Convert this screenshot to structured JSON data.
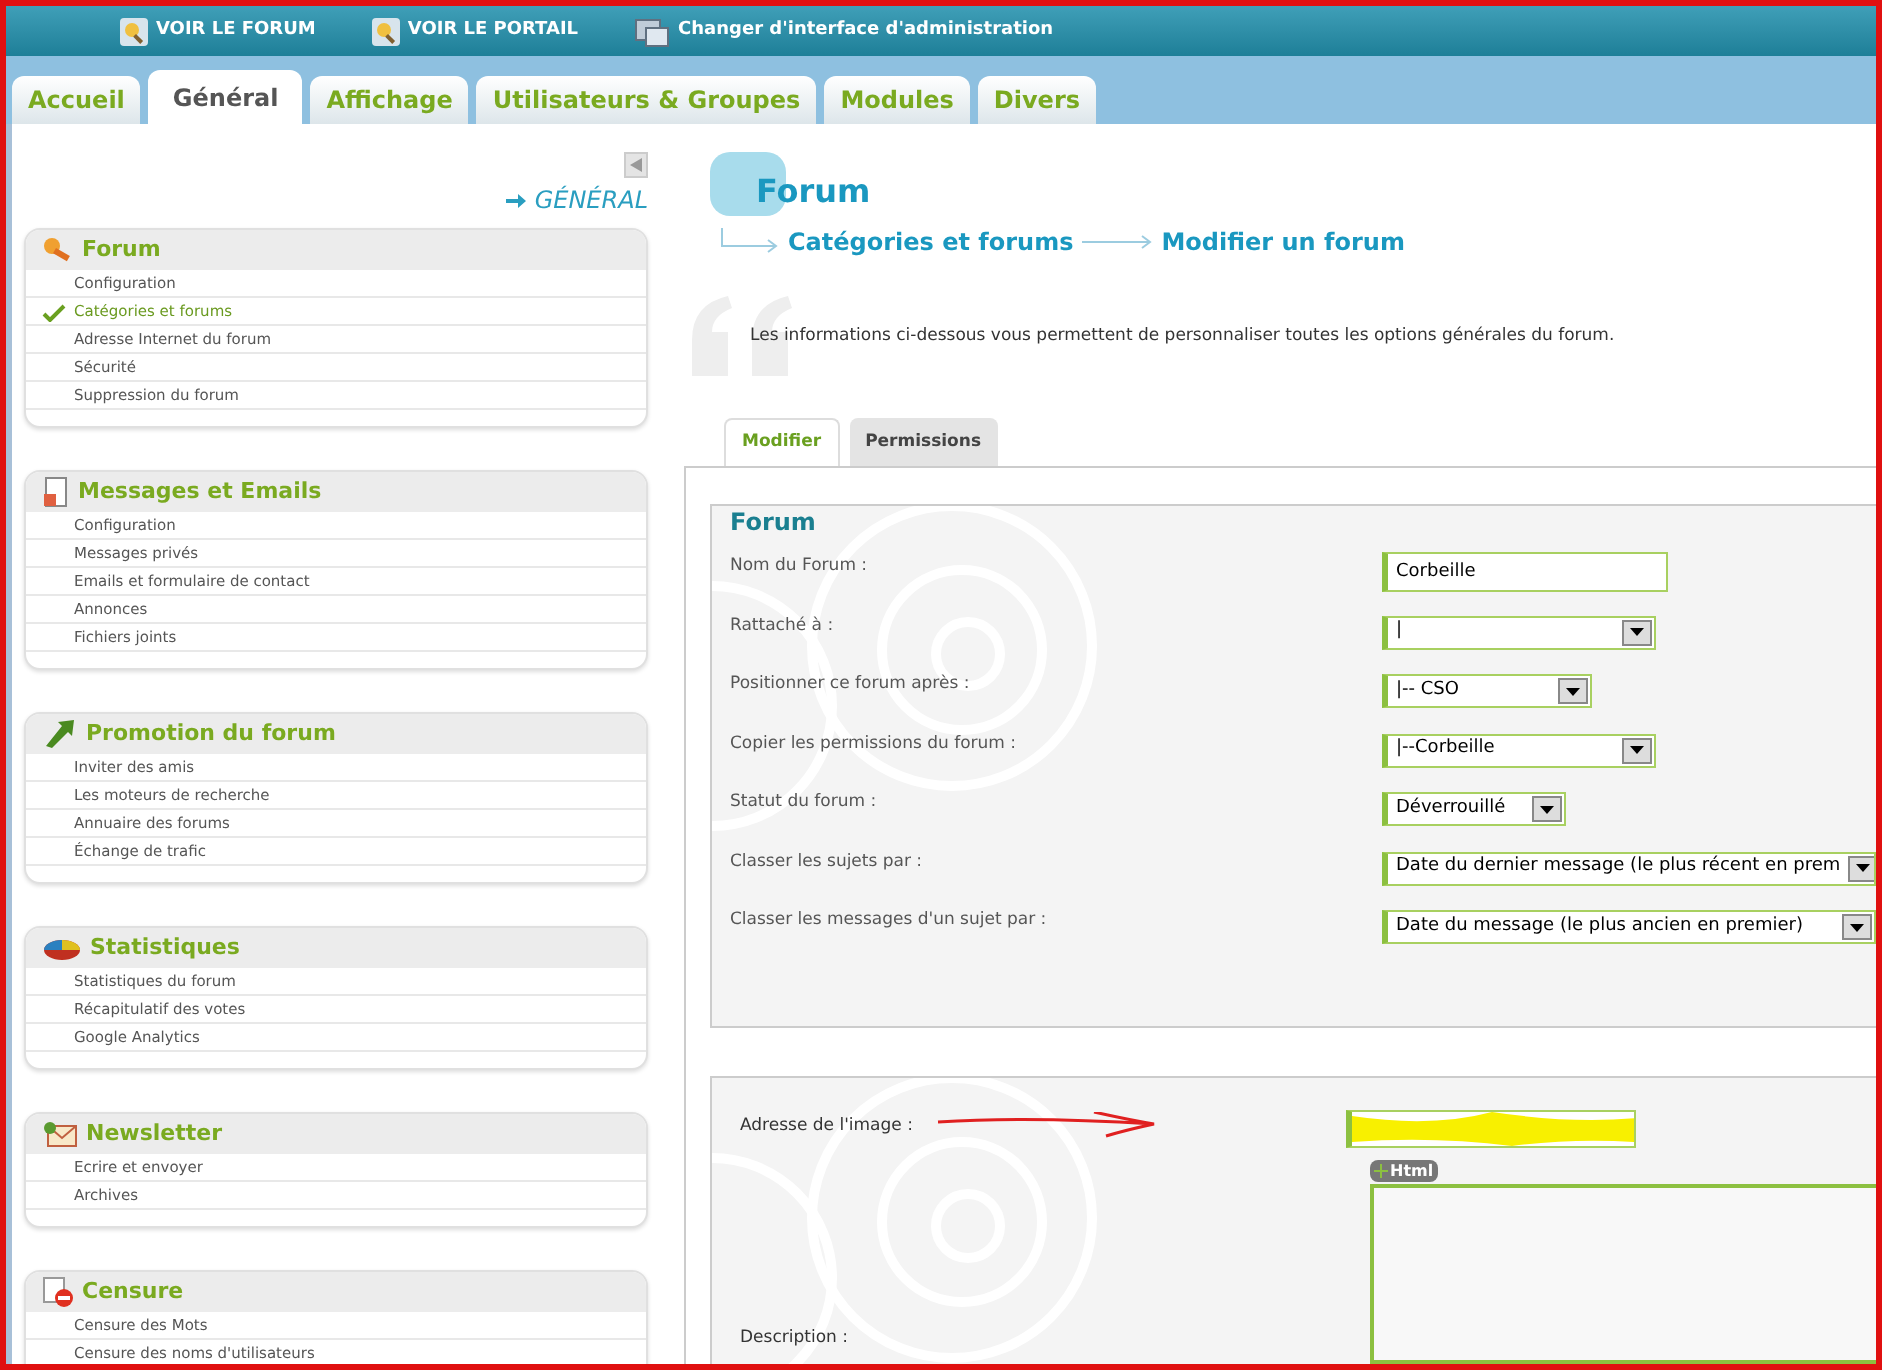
{
  "top_links": [
    {
      "label": "VOIR LE FORUM",
      "kind": "forum"
    },
    {
      "label": "VOIR LE PORTAIL",
      "kind": "portal"
    },
    {
      "label": "Changer d'interface d'administration",
      "kind": "switch"
    }
  ],
  "tabs": [
    {
      "label": "Accueil",
      "selected": false
    },
    {
      "label": "Général",
      "selected": true
    },
    {
      "label": "Affichage",
      "selected": false
    },
    {
      "label": "Utilisateurs & Groupes",
      "selected": false
    },
    {
      "label": "Modules",
      "selected": false
    },
    {
      "label": "Divers",
      "selected": false
    }
  ],
  "sidebar": {
    "section_title": "GÉNÉRAL",
    "groups": [
      {
        "title": "Forum",
        "kind": "forum",
        "items": [
          {
            "label": "Configuration",
            "selected": false
          },
          {
            "label": "Catégories et forums",
            "selected": true
          },
          {
            "label": "Adresse Internet du forum",
            "selected": false
          },
          {
            "label": "Sécurité",
            "selected": false
          },
          {
            "label": "Suppression du forum",
            "selected": false
          }
        ]
      },
      {
        "title": "Messages et Emails",
        "kind": "messages",
        "items": [
          {
            "label": "Configuration",
            "selected": false
          },
          {
            "label": "Messages privés",
            "selected": false
          },
          {
            "label": "Emails et formulaire de contact",
            "selected": false
          },
          {
            "label": "Annonces",
            "selected": false
          },
          {
            "label": "Fichiers joints",
            "selected": false
          }
        ]
      },
      {
        "title": "Promotion du forum",
        "kind": "promotion",
        "items": [
          {
            "label": "Inviter des amis",
            "selected": false
          },
          {
            "label": "Les moteurs de recherche",
            "selected": false
          },
          {
            "label": "Annuaire des forums",
            "selected": false
          },
          {
            "label": "Échange de trafic",
            "selected": false
          }
        ]
      },
      {
        "title": "Statistiques",
        "kind": "stats",
        "items": [
          {
            "label": "Statistiques du forum",
            "selected": false
          },
          {
            "label": "Récapitulatif des votes",
            "selected": false
          },
          {
            "label": "Google Analytics",
            "selected": false
          }
        ]
      },
      {
        "title": "Newsletter",
        "kind": "newsletter",
        "items": [
          {
            "label": "Ecrire et envoyer",
            "selected": false
          },
          {
            "label": "Archives",
            "selected": false
          }
        ]
      },
      {
        "title": "Censure",
        "kind": "censure",
        "items": [
          {
            "label": "Censure des Mots",
            "selected": false
          },
          {
            "label": "Censure des noms d'utilisateurs",
            "selected": false
          }
        ]
      }
    ]
  },
  "page": {
    "title": "Forum",
    "breadcrumb": [
      "Catégories et forums",
      "Modifier un forum"
    ],
    "intro": "Les informations ci-dessous vous permettent de personnaliser toutes les options générales du forum.",
    "subtabs": [
      {
        "label": "Modifier",
        "selected": true
      },
      {
        "label": "Permissions",
        "selected": false
      }
    ],
    "fieldset": {
      "legend": "Forum",
      "fields": [
        {
          "label": "Nom du Forum :",
          "kind": "text",
          "value": "Corbeille"
        },
        {
          "label": "Rattaché à :",
          "kind": "select",
          "value": "|"
        },
        {
          "label": "Positionner ce forum après :",
          "kind": "select",
          "value": "|-- CSO"
        },
        {
          "label": "Copier les permissions du forum :",
          "kind": "select",
          "value": "|--Corbeille"
        },
        {
          "label": "Statut du forum :",
          "kind": "select",
          "value": "Déverrouillé"
        },
        {
          "label": "Classer les sujets par :",
          "kind": "select",
          "value": "Date du dernier message (le plus récent en prem"
        },
        {
          "label": "Classer les messages d'un sujet par :",
          "kind": "select",
          "value": "Date du message (le plus ancien en premier)"
        }
      ]
    },
    "image_field": {
      "label": "Adresse de l'image :"
    },
    "html_button": "Html",
    "description_label": "Description :"
  }
}
